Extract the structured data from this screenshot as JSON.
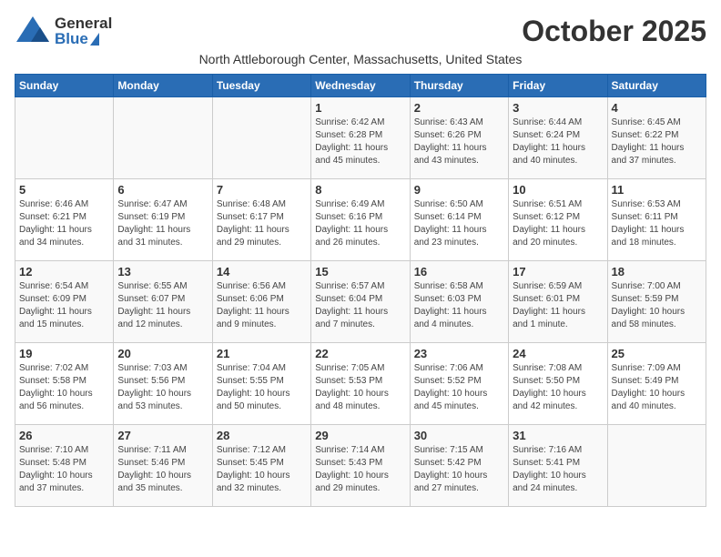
{
  "header": {
    "logo_general": "General",
    "logo_blue": "Blue",
    "month_title": "October 2025",
    "location": "North Attleborough Center, Massachusetts, United States"
  },
  "days_of_week": [
    "Sunday",
    "Monday",
    "Tuesday",
    "Wednesday",
    "Thursday",
    "Friday",
    "Saturday"
  ],
  "weeks": [
    [
      {
        "num": "",
        "info": ""
      },
      {
        "num": "",
        "info": ""
      },
      {
        "num": "",
        "info": ""
      },
      {
        "num": "1",
        "info": "Sunrise: 6:42 AM\nSunset: 6:28 PM\nDaylight: 11 hours\nand 45 minutes."
      },
      {
        "num": "2",
        "info": "Sunrise: 6:43 AM\nSunset: 6:26 PM\nDaylight: 11 hours\nand 43 minutes."
      },
      {
        "num": "3",
        "info": "Sunrise: 6:44 AM\nSunset: 6:24 PM\nDaylight: 11 hours\nand 40 minutes."
      },
      {
        "num": "4",
        "info": "Sunrise: 6:45 AM\nSunset: 6:22 PM\nDaylight: 11 hours\nand 37 minutes."
      }
    ],
    [
      {
        "num": "5",
        "info": "Sunrise: 6:46 AM\nSunset: 6:21 PM\nDaylight: 11 hours\nand 34 minutes."
      },
      {
        "num": "6",
        "info": "Sunrise: 6:47 AM\nSunset: 6:19 PM\nDaylight: 11 hours\nand 31 minutes."
      },
      {
        "num": "7",
        "info": "Sunrise: 6:48 AM\nSunset: 6:17 PM\nDaylight: 11 hours\nand 29 minutes."
      },
      {
        "num": "8",
        "info": "Sunrise: 6:49 AM\nSunset: 6:16 PM\nDaylight: 11 hours\nand 26 minutes."
      },
      {
        "num": "9",
        "info": "Sunrise: 6:50 AM\nSunset: 6:14 PM\nDaylight: 11 hours\nand 23 minutes."
      },
      {
        "num": "10",
        "info": "Sunrise: 6:51 AM\nSunset: 6:12 PM\nDaylight: 11 hours\nand 20 minutes."
      },
      {
        "num": "11",
        "info": "Sunrise: 6:53 AM\nSunset: 6:11 PM\nDaylight: 11 hours\nand 18 minutes."
      }
    ],
    [
      {
        "num": "12",
        "info": "Sunrise: 6:54 AM\nSunset: 6:09 PM\nDaylight: 11 hours\nand 15 minutes."
      },
      {
        "num": "13",
        "info": "Sunrise: 6:55 AM\nSunset: 6:07 PM\nDaylight: 11 hours\nand 12 minutes."
      },
      {
        "num": "14",
        "info": "Sunrise: 6:56 AM\nSunset: 6:06 PM\nDaylight: 11 hours\nand 9 minutes."
      },
      {
        "num": "15",
        "info": "Sunrise: 6:57 AM\nSunset: 6:04 PM\nDaylight: 11 hours\nand 7 minutes."
      },
      {
        "num": "16",
        "info": "Sunrise: 6:58 AM\nSunset: 6:03 PM\nDaylight: 11 hours\nand 4 minutes."
      },
      {
        "num": "17",
        "info": "Sunrise: 6:59 AM\nSunset: 6:01 PM\nDaylight: 11 hours\nand 1 minute."
      },
      {
        "num": "18",
        "info": "Sunrise: 7:00 AM\nSunset: 5:59 PM\nDaylight: 10 hours\nand 58 minutes."
      }
    ],
    [
      {
        "num": "19",
        "info": "Sunrise: 7:02 AM\nSunset: 5:58 PM\nDaylight: 10 hours\nand 56 minutes."
      },
      {
        "num": "20",
        "info": "Sunrise: 7:03 AM\nSunset: 5:56 PM\nDaylight: 10 hours\nand 53 minutes."
      },
      {
        "num": "21",
        "info": "Sunrise: 7:04 AM\nSunset: 5:55 PM\nDaylight: 10 hours\nand 50 minutes."
      },
      {
        "num": "22",
        "info": "Sunrise: 7:05 AM\nSunset: 5:53 PM\nDaylight: 10 hours\nand 48 minutes."
      },
      {
        "num": "23",
        "info": "Sunrise: 7:06 AM\nSunset: 5:52 PM\nDaylight: 10 hours\nand 45 minutes."
      },
      {
        "num": "24",
        "info": "Sunrise: 7:08 AM\nSunset: 5:50 PM\nDaylight: 10 hours\nand 42 minutes."
      },
      {
        "num": "25",
        "info": "Sunrise: 7:09 AM\nSunset: 5:49 PM\nDaylight: 10 hours\nand 40 minutes."
      }
    ],
    [
      {
        "num": "26",
        "info": "Sunrise: 7:10 AM\nSunset: 5:48 PM\nDaylight: 10 hours\nand 37 minutes."
      },
      {
        "num": "27",
        "info": "Sunrise: 7:11 AM\nSunset: 5:46 PM\nDaylight: 10 hours\nand 35 minutes."
      },
      {
        "num": "28",
        "info": "Sunrise: 7:12 AM\nSunset: 5:45 PM\nDaylight: 10 hours\nand 32 minutes."
      },
      {
        "num": "29",
        "info": "Sunrise: 7:14 AM\nSunset: 5:43 PM\nDaylight: 10 hours\nand 29 minutes."
      },
      {
        "num": "30",
        "info": "Sunrise: 7:15 AM\nSunset: 5:42 PM\nDaylight: 10 hours\nand 27 minutes."
      },
      {
        "num": "31",
        "info": "Sunrise: 7:16 AM\nSunset: 5:41 PM\nDaylight: 10 hours\nand 24 minutes."
      },
      {
        "num": "",
        "info": ""
      }
    ]
  ]
}
